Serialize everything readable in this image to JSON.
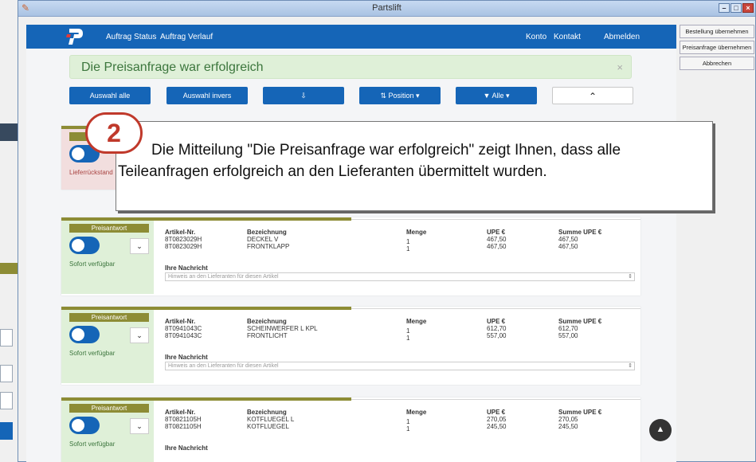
{
  "window": {
    "title": "Partslift"
  },
  "navbar": {
    "status": "Auftrag Status",
    "history": "Auftrag Verlauf",
    "konto": "Konto",
    "kontakt": "Kontakt",
    "abmelden": "Abmelden"
  },
  "alert": {
    "text": "Die Preisanfrage war erfolgreich",
    "close": "×"
  },
  "toolbar": {
    "select_all": "Auswahl alle",
    "select_inverse": "Auswahl invers",
    "sort_icon": "⇩",
    "position": "⇅  Position ▾",
    "filter": "▼  Alle ▾",
    "collapse": "⌃"
  },
  "side_buttons": {
    "order": "Bestellung übernehmen",
    "price_request": "Preisanfrage übernehmen",
    "cancel": "Abbrechen"
  },
  "callout": {
    "number": "2",
    "message": "Die Mitteilung \"Die Preisanfrage war erfolgreich\" zeigt Ihnen, dass alle Teileanfragen erfolgreich an den Lieferanten übermittelt wurden."
  },
  "first_card": {
    "status": "Lieferrückstand"
  },
  "labels": {
    "badge": "Preisantwort",
    "available": "Sofort verfügbar",
    "article_no": "Artikel-Nr.",
    "description": "Bezeichnung",
    "quantity": "Menge",
    "upe": "UPE €",
    "sum_upe": "Summe UPE €",
    "your_message": "Ihre Nachricht",
    "note_placeholder": "Hinweis an den Lieferanten für diesen Artikel"
  },
  "cards": [
    {
      "rows": [
        {
          "article": "8T0823029H",
          "desc": "DECKEL V",
          "qty": "1",
          "upe": "467,50",
          "sum": "467,50"
        },
        {
          "article": "8T0823029H",
          "desc": "FRONTKLAPP",
          "qty": "1",
          "upe": "467,50",
          "sum": "467,50"
        }
      ]
    },
    {
      "rows": [
        {
          "article": "8T0941043C",
          "desc": "SCHEINWERFER L KPL",
          "qty": "1",
          "upe": "612,70",
          "sum": "612,70"
        },
        {
          "article": "8T0941043C",
          "desc": "FRONTLICHT",
          "qty": "1",
          "upe": "557,00",
          "sum": "557,00"
        }
      ]
    },
    {
      "rows": [
        {
          "article": "8T0821105H",
          "desc": "KOTFLUEGEL L",
          "qty": "1",
          "upe": "270,05",
          "sum": "270,05"
        },
        {
          "article": "8T0821105H",
          "desc": "KOTFLUEGEL",
          "qty": "1",
          "upe": "245,50",
          "sum": "245,50"
        }
      ]
    }
  ]
}
